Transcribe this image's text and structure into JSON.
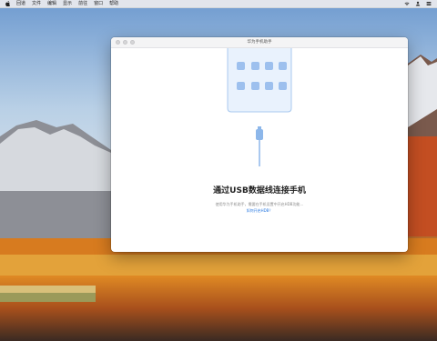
{
  "menubar": {
    "items": [
      "回道",
      "文件",
      "编辑",
      "显示",
      "前往",
      "窗口",
      "帮助"
    ],
    "icons": [
      "apple-icon",
      "wifi-icon",
      "user-icon",
      "control-center-icon"
    ]
  },
  "window": {
    "title": "华为手机助手",
    "main_title": "通过USB数据线连接手机",
    "sub_text": "使用华为手机助手，需要在手机设置中开启HDB功能…",
    "help_link": "如何开启HDB？"
  },
  "colors": {
    "accent": "#2a7ae2",
    "illustration_bg": "#e9f2fd",
    "illustration_stroke": "#a9c8ef",
    "app_icon": "#9dc0ee"
  }
}
